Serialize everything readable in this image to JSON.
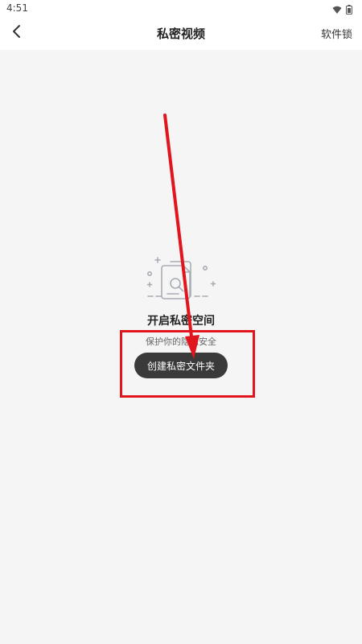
{
  "status_bar": {
    "time": "4:51",
    "icons": [
      "wifi-icon",
      "battery-icon"
    ]
  },
  "header": {
    "back_icon": "chevron-left-icon",
    "title": "私密视频",
    "right_action": "软件锁"
  },
  "empty_state": {
    "icon": "document-search-icon",
    "title": "开启私密空间",
    "subtitle": "保护你的隐私安全",
    "button_label": "创建私密文件夹"
  },
  "colors": {
    "background": "#f5f5f5",
    "header_background": "#ffffff",
    "button_background": "#3a3a3a",
    "button_text": "#ffffff",
    "annotation": "#e0151d"
  },
  "annotation": {
    "type": "arrow-and-box",
    "target": "create-folder-button"
  }
}
